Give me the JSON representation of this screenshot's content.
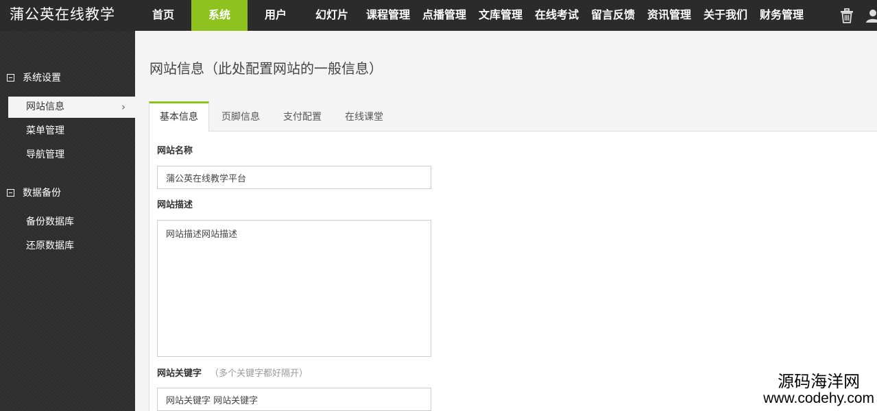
{
  "brand": "蒲公英在线教学",
  "nav": [
    {
      "label": "首页"
    },
    {
      "label": "系统",
      "active": true
    },
    {
      "label": "用户"
    },
    {
      "label": "幻灯片"
    },
    {
      "label": "课程管理"
    },
    {
      "label": "点播管理"
    },
    {
      "label": "文库管理"
    },
    {
      "label": "在线考试"
    },
    {
      "label": "留言反馈"
    },
    {
      "label": "资讯管理"
    },
    {
      "label": "关于我们"
    },
    {
      "label": "财务管理"
    }
  ],
  "top_icons": [
    "trash-icon",
    "user-icon"
  ],
  "sidebar": {
    "groups": [
      {
        "title": "系统设置",
        "items": [
          {
            "label": "网站信息",
            "active": true
          },
          {
            "label": "菜单管理"
          },
          {
            "label": "导航管理"
          }
        ]
      },
      {
        "title": "数据备份",
        "items": [
          {
            "label": "备份数据库"
          },
          {
            "label": "还原数据库"
          }
        ]
      }
    ]
  },
  "page_title": "网站信息（此处配置网站的一般信息）",
  "tabs": [
    {
      "label": "基本信息",
      "active": true
    },
    {
      "label": "页脚信息"
    },
    {
      "label": "支付配置"
    },
    {
      "label": "在线课堂"
    }
  ],
  "form": {
    "site_name": {
      "label": "网站名称",
      "value": "蒲公英在线教学平台"
    },
    "site_desc": {
      "label": "网站描述",
      "value": "网站描述网站描述"
    },
    "site_keywords": {
      "label": "网站关键字",
      "hint": "（多个关键字都好隔开）",
      "value": "网站关键字 网站关键字"
    }
  },
  "watermark": {
    "line1": "源码海洋网",
    "line2": "www.codehy.com"
  },
  "colors": {
    "topbar": "#2b2b2b",
    "accent": "#8dc21f",
    "sidebar": "#2e2e2e",
    "background": "#f4f4f4"
  }
}
